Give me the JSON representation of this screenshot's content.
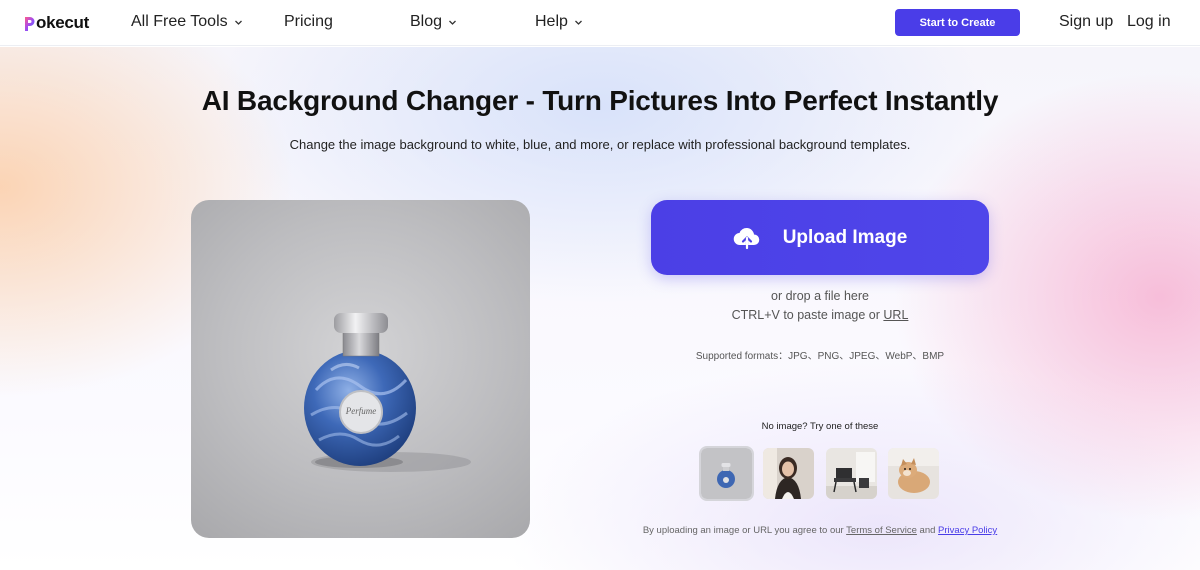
{
  "brand": {
    "name": "Pokecut",
    "accent": "#4a3de8"
  },
  "header": {
    "logo_text": "okecut",
    "nav": [
      {
        "label": "All Free Tools",
        "dropdown": true
      },
      {
        "label": "Pricing",
        "dropdown": false
      },
      {
        "label": "Blog",
        "dropdown": true
      },
      {
        "label": "Help",
        "dropdown": true
      }
    ],
    "cta_label": "Start to Create",
    "signup_label": "Sign up",
    "login_label": "Log in"
  },
  "hero": {
    "title": "AI Background Changer - Turn Pictures Into Perfect Instantly",
    "subtitle": "Change the image background to white, blue, and more, or replace with professional background templates."
  },
  "upload": {
    "button_label": "Upload Image",
    "button_icon": "cloud-upload-icon",
    "drop_text": "or drop a file here",
    "paste_prefix": "CTRL+V to paste image or ",
    "paste_link": "URL",
    "formats": "Supported formats：JPG、PNG、JPEG、WebP、BMP"
  },
  "samples": {
    "label": "No image? Try one of these",
    "items": [
      "perfume-bottle",
      "woman-portrait",
      "chair-interior",
      "shiba-dog"
    ]
  },
  "terms": {
    "prefix": "By uploading an image or URL you agree to our ",
    "tos": "Terms of Service",
    "and": " and ",
    "privacy": "Privacy Policy"
  }
}
